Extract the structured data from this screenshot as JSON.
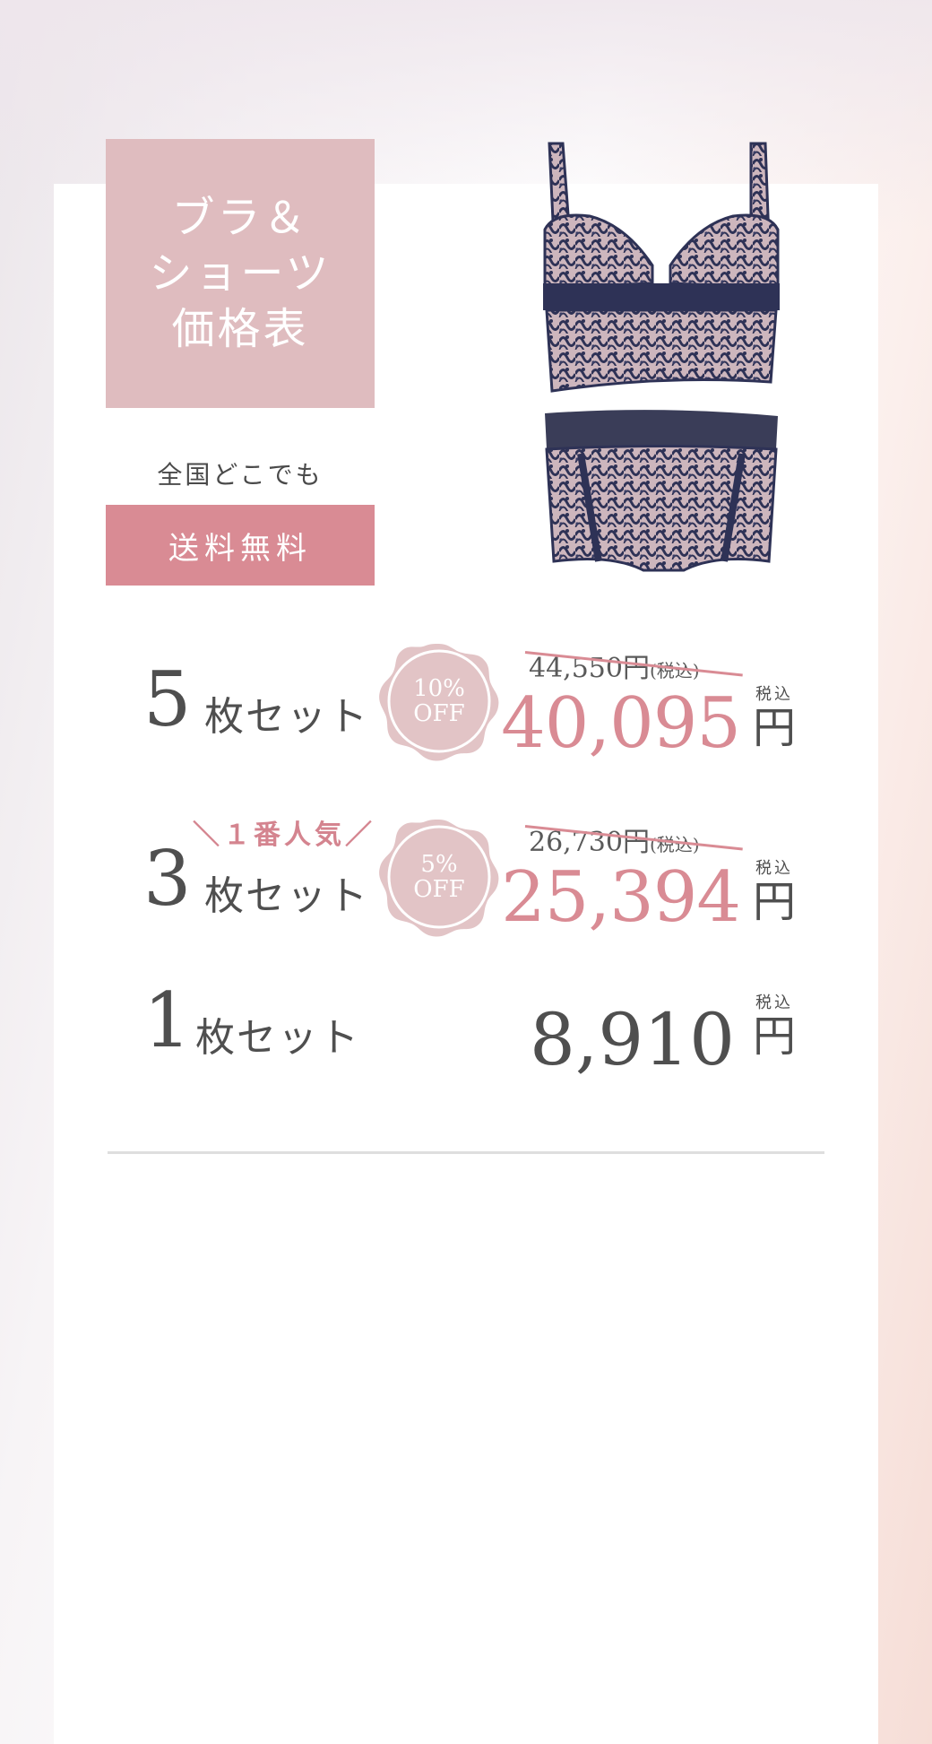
{
  "title": "ブラ＆\nショーツ\n価格表",
  "shipping": {
    "note": "全国どこでも",
    "badge": "送料無料"
  },
  "rows": [
    {
      "quantity": "5",
      "unit_label": "枚セット",
      "discount": {
        "percent": "10%",
        "off": "OFF"
      },
      "original_price": "44,550円",
      "original_tax": "(税込)",
      "price": "40,095",
      "tax_label": "税込",
      "yen": "円"
    },
    {
      "quantity": "3",
      "unit_label": "枚セット",
      "badge": "＼１番人気／",
      "discount": {
        "percent": "5%",
        "off": "OFF"
      },
      "original_price": "26,730円",
      "original_tax": "(税込)",
      "price": "25,394",
      "tax_label": "税込",
      "yen": "円"
    },
    {
      "quantity": "1",
      "unit_label": "枚セット",
      "price": "8,910",
      "tax_label": "税込",
      "yen": "円"
    }
  ],
  "colors": {
    "accent_pink": "#d98b94",
    "title_bg": "#dfbcbf",
    "badge_bg": "#e0c2c4",
    "text_dark": "#4f4f4f",
    "lingerie_navy": "#2e3256"
  },
  "icons": [
    "lingerie-set-image",
    "discount-badge-shape"
  ]
}
